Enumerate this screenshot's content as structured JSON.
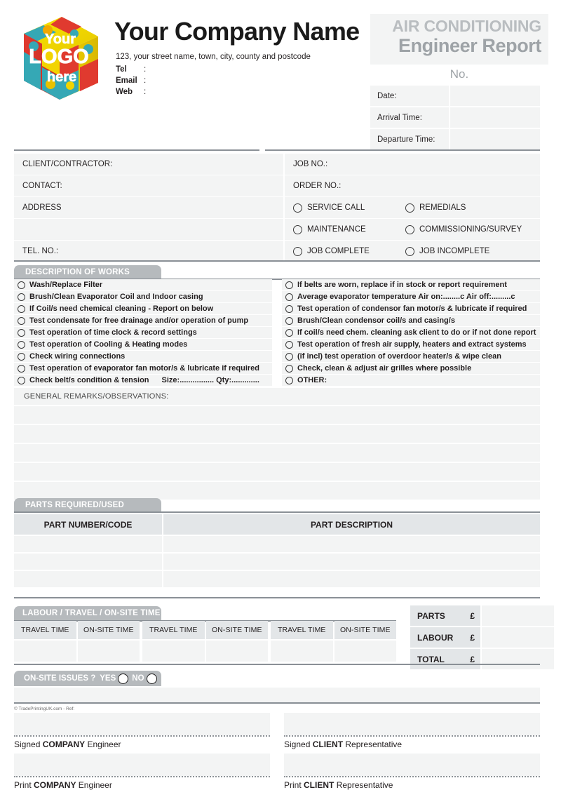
{
  "header": {
    "logo_alt": "Your LOGO here",
    "logo_lines": [
      "Your",
      "LOGO",
      "here"
    ],
    "company_name": "Your Company Name",
    "address": "123, your street name, town, city, county and postcode",
    "contacts": [
      {
        "label": "Tel",
        "colon": ":",
        "value": ""
      },
      {
        "label": "Email",
        "colon": ":",
        "value": ""
      },
      {
        "label": "Web",
        "colon": ":",
        "value": ""
      }
    ],
    "title_line1": "AIR CONDITIONING",
    "title_line2": "Engineer Report",
    "no_label": "No.",
    "fields": [
      {
        "label": "Date:",
        "value": ""
      },
      {
        "label": "Arrival Time:",
        "value": ""
      },
      {
        "label": "Departure Time:",
        "value": ""
      }
    ]
  },
  "client": {
    "rows": [
      {
        "left": "CLIENT/CONTRACTOR:",
        "right_label": "JOB NO.:"
      },
      {
        "left": "CONTACT:",
        "right_label": "ORDER NO.:"
      },
      {
        "left": "ADDRESS",
        "options": [
          "SERVICE CALL",
          "REMEDIALS"
        ]
      },
      {
        "left": "",
        "options": [
          "MAINTENANCE",
          "COMMISSIONING/SURVEY"
        ]
      },
      {
        "left": "TEL. NO.:",
        "options": [
          "JOB COMPLETE",
          "JOB INCOMPLETE"
        ]
      }
    ]
  },
  "works": {
    "section_title": "DESCRIPTION OF WORKS",
    "left_items": [
      {
        "text": "Wash/Replace Filter",
        "extra": ""
      },
      {
        "text": "Brush/Clean Evaporator Coil and Indoor casing",
        "extra": ""
      },
      {
        "text": "If Coil/s need chemical cleaning - Report on below",
        "extra": ""
      },
      {
        "text": "Test condensate for free drainage and/or operation of pump",
        "extra": ""
      },
      {
        "text": "Test operation of time clock & record settings",
        "extra": ""
      },
      {
        "text": "Test operation of Cooling & Heating modes",
        "extra": ""
      },
      {
        "text": "Check wiring connections",
        "extra": ""
      },
      {
        "text": "Test operation of evaporator fan motor/s & lubricate if required",
        "extra": ""
      },
      {
        "text": "Check belt/s condition & tension",
        "extra": "Size:................  Qty:............."
      }
    ],
    "right_items": [
      {
        "text": "If belts are worn, replace if in stock or report requirement",
        "extra": ""
      },
      {
        "text": "Average evaporator temperature   Air on:........c   Air off:.........c",
        "extra": ""
      },
      {
        "text": "Test operation of condensor fan motor/s & lubricate if required",
        "extra": ""
      },
      {
        "text": "Brush/Clean condensor coil/s and casing/s",
        "extra": ""
      },
      {
        "text": "If coil/s need chem. cleaning ask client to do or if not done report",
        "extra": ""
      },
      {
        "text": "Test operation of fresh air supply, heaters and extract systems",
        "extra": ""
      },
      {
        "text": "(if incl) test operation of overdoor heater/s & wipe clean",
        "extra": ""
      },
      {
        "text": "Check, clean & adjust air grilles where possible",
        "extra": ""
      },
      {
        "text": "OTHER:",
        "extra": ""
      }
    ]
  },
  "remarks": {
    "label": "GENERAL REMARKS/OBSERVATIONS:",
    "blank_lines": 5
  },
  "parts": {
    "section_title": "PARTS REQUIRED/USED",
    "columns": [
      "PART NUMBER/CODE",
      "PART DESCRIPTION"
    ],
    "rows": [
      {
        "number": "",
        "description": ""
      },
      {
        "number": "",
        "description": ""
      },
      {
        "number": "",
        "description": ""
      }
    ]
  },
  "labour": {
    "section_title": "LABOUR / TRAVEL / ON-SITE TIME",
    "groups": [
      {
        "travel_header": "TRAVEL TIME",
        "onsite_header": "ON-SITE TIME",
        "travel_value": "",
        "onsite_value": ""
      },
      {
        "travel_header": "TRAVEL TIME",
        "onsite_header": "ON-SITE TIME",
        "travel_value": "",
        "onsite_value": ""
      },
      {
        "travel_header": "TRAVEL TIME",
        "onsite_header": "ON-SITE TIME",
        "travel_value": "",
        "onsite_value": ""
      }
    ],
    "totals": [
      {
        "label": "PARTS",
        "currency": "£",
        "value": ""
      },
      {
        "label": "LABOUR",
        "currency": "£",
        "value": ""
      },
      {
        "label": "TOTAL",
        "currency": "£",
        "value": ""
      }
    ]
  },
  "issues": {
    "question": "ON-SITE ISSUES ?",
    "yes_label": "YES",
    "no_label": "NO"
  },
  "footer": {
    "credit": "© TradePrintingUK.com - Ref:",
    "signatures": [
      {
        "prefix": "Signed ",
        "strong": "COMPANY",
        "suffix": " Engineer",
        "value": ""
      },
      {
        "prefix": "Signed ",
        "strong": "CLIENT",
        "suffix": " Representative",
        "value": ""
      },
      {
        "prefix": "Print ",
        "strong": "COMPANY",
        "suffix": " Engineer",
        "value": ""
      },
      {
        "prefix": "Print ",
        "strong": "CLIENT",
        "suffix": " Representative",
        "value": ""
      }
    ]
  },
  "colors": {
    "field_bg": "#f3f4f4",
    "tab_gray": "#b6babd",
    "header_gray": "#e3e6e8",
    "title_light": "#b9bdc0",
    "title_dark": "#9ea3a7",
    "rule": "#8a9096"
  }
}
